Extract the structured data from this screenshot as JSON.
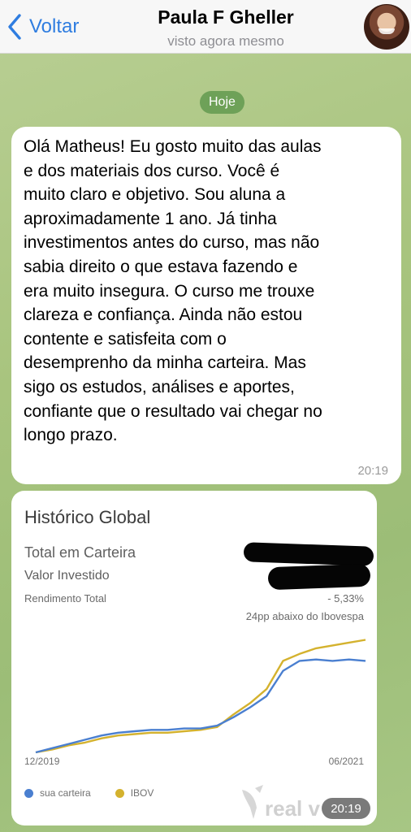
{
  "header": {
    "back_label": "Voltar",
    "contact_name": "Paula F Gheller",
    "status": "visto agora mesmo",
    "avatar_icon": "contact-avatar"
  },
  "date_chip": "Hoje",
  "message": {
    "text": "Olá Matheus! Eu gosto muito das aulas\ne dos materiais dos curso. Você é\nmuito claro e objetivo. Sou aluna  a\naproximadamente 1 ano. Já tinha\ninvestimentos antes do curso, mas não\nsabia direito o que estava fazendo e\nera muito insegura. O curso me trouxe\nclareza e confiança. Ainda não estou\ncontente e satisfeita com o\ndesemprenho da minha carteira. Mas\nsigo os estudos, análises e aportes,\nconfiante que o resultado vai chegar no\nlongo prazo.",
    "time": "20:19"
  },
  "image_message": {
    "time": "20:19",
    "card": {
      "title": "Histórico Global",
      "total_label": "Total em Carteira",
      "invested_label": "Valor Investido",
      "return_label": "Rendimento Total",
      "return_value": "- 5,33%",
      "comparison_note": "24pp abaixo do Ibovespa",
      "logo_text": "real v"
    }
  },
  "colors": {
    "accent_blue": "#2f7de0",
    "date_chip": "#6ea158",
    "series_carteira": "#4a7fd0",
    "series_ibov": "#d4b22e"
  },
  "chart_data": {
    "type": "line",
    "x_start": "12/2019",
    "x_end": "06/2021",
    "x": [
      0,
      0.05,
      0.1,
      0.15,
      0.2,
      0.25,
      0.3,
      0.35,
      0.4,
      0.45,
      0.5,
      0.55,
      0.6,
      0.65,
      0.7,
      0.75,
      0.8,
      0.85,
      0.9,
      0.95,
      1.0
    ],
    "series": [
      {
        "name": "sua carteira",
        "values": [
          0,
          3,
          6,
          9,
          12,
          14,
          15,
          16,
          16,
          17,
          17,
          19,
          25,
          32,
          40,
          58,
          65,
          66,
          65,
          66,
          65
        ]
      },
      {
        "name": "IBOV",
        "values": [
          0,
          2,
          5,
          7,
          10,
          12,
          13,
          14,
          14,
          15,
          16,
          18,
          27,
          35,
          45,
          65,
          70,
          74,
          76,
          78,
          80
        ]
      }
    ],
    "legend": "bottom-left",
    "grid": false
  }
}
